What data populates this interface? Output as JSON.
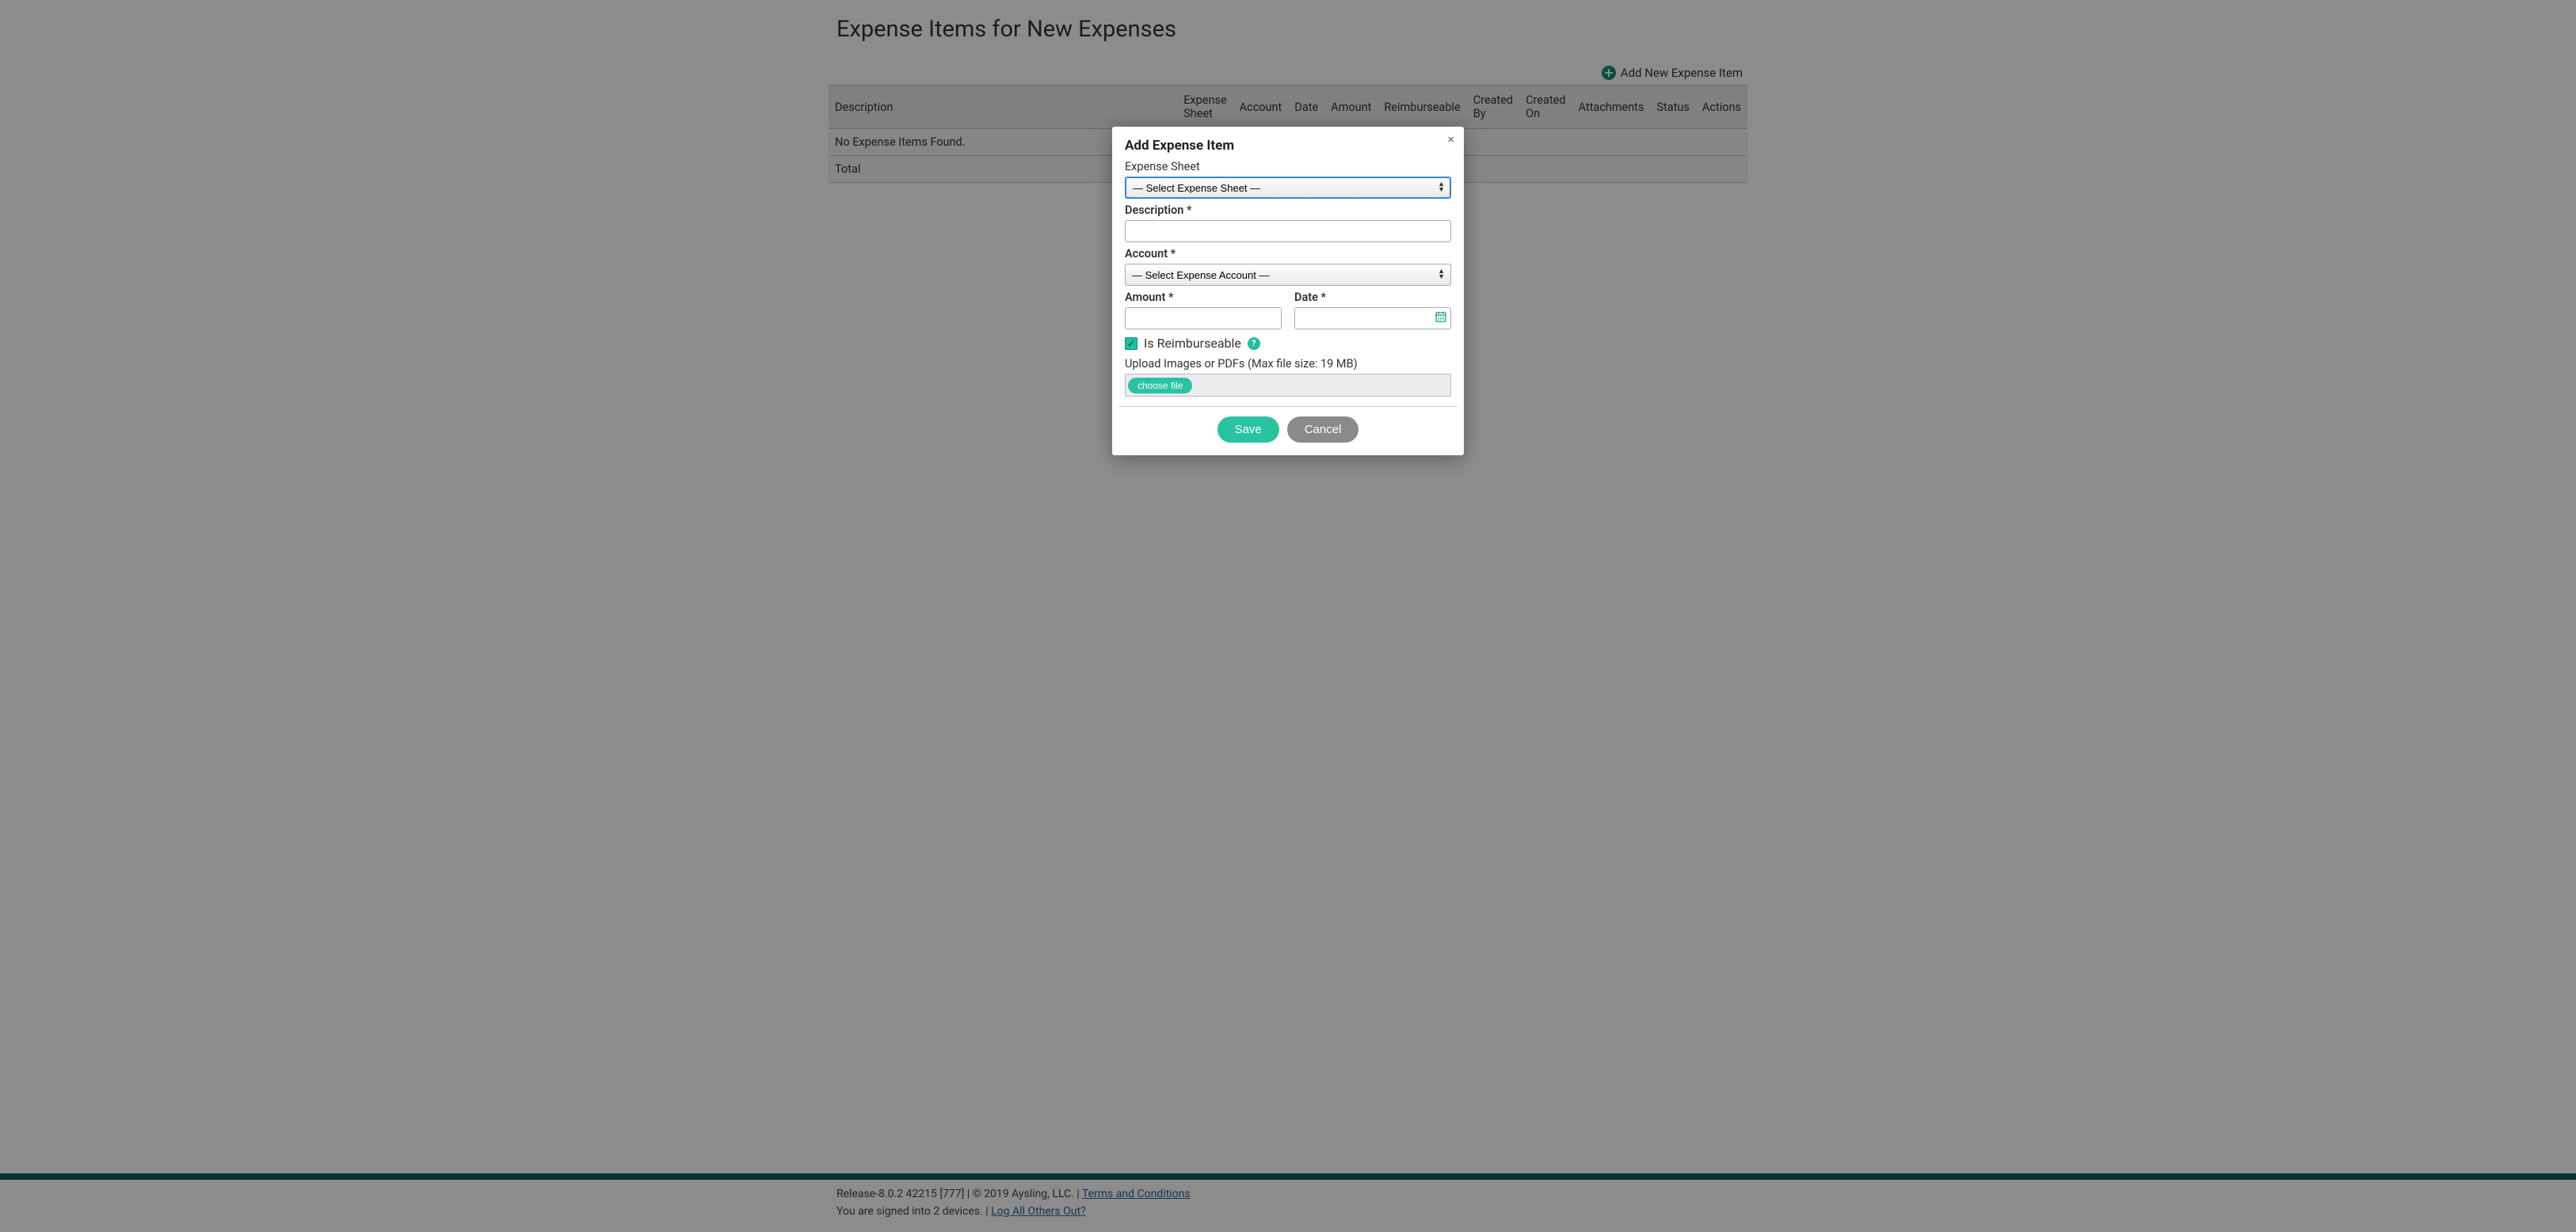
{
  "page": {
    "title": "Expense Items for New Expenses",
    "addNewLabel": "Add New Expense Item"
  },
  "table": {
    "columns": {
      "description": "Description",
      "expenseSheet": "Expense Sheet",
      "account": "Account",
      "date": "Date",
      "amount": "Amount",
      "reimburseable": "Reimburseable",
      "createdBy": "Created By",
      "createdOn": "Created On",
      "attachments": "Attachments",
      "status": "Status",
      "actions": "Actions"
    },
    "emptyMessage": "No Expense Items Found.",
    "totalLabel": "Total"
  },
  "modal": {
    "title": "Add Expense Item",
    "closeGlyph": "×",
    "fields": {
      "expenseSheet": {
        "label": "Expense Sheet",
        "placeholder": "— Select Expense Sheet —"
      },
      "description": {
        "label": "Description *"
      },
      "account": {
        "label": "Account *",
        "placeholder": "— Select Expense Account —"
      },
      "amount": {
        "label": "Amount *"
      },
      "date": {
        "label": "Date *"
      },
      "reimburseable": {
        "label": "Is Reimburseable",
        "checked": true
      },
      "upload": {
        "label": "Upload Images or PDFs (Max file size: 19 MB)",
        "buttonLabel": "choose file"
      }
    },
    "buttons": {
      "save": "Save",
      "cancel": "Cancel"
    }
  },
  "footer": {
    "release": "Release-8.0.2 42215 [777]",
    "sep1": " | ",
    "copyright": "© 2019 Aysling, LLC.",
    "sep2": " | ",
    "termsLabel": "Terms and Conditions",
    "signedInPrefix": "You are signed into 2 devices. | ",
    "logoutLabel": "Log All Others Out?"
  }
}
